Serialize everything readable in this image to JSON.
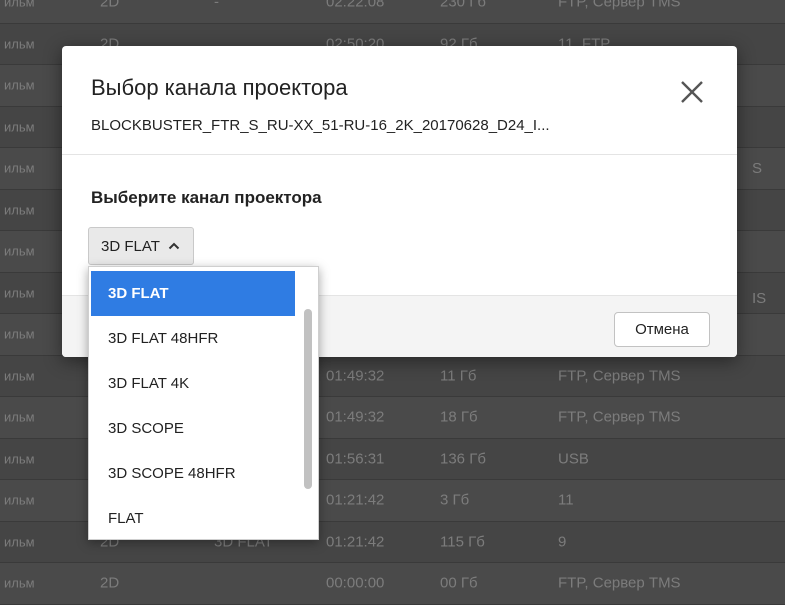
{
  "background_table": {
    "rows": [
      [
        "ильм",
        "2D",
        "-",
        "02:22:08",
        "230 Гб",
        "FTP, Сервер TMS"
      ],
      [
        "ильм",
        "2D",
        "",
        "02:50:20",
        "92 Гб",
        "11, FTP"
      ],
      [
        "ильм",
        "",
        "",
        "",
        "",
        ""
      ],
      [
        "ильм",
        "",
        "",
        "",
        "",
        ""
      ],
      [
        "ильм",
        "",
        "",
        "",
        "",
        ""
      ],
      [
        "ильм",
        "",
        "",
        "",
        "",
        ""
      ],
      [
        "ильм",
        "",
        "",
        "",
        "",
        ""
      ],
      [
        "ильм",
        "",
        "",
        "",
        "",
        ""
      ],
      [
        "ильм",
        "",
        "",
        "",
        "",
        ""
      ],
      [
        "ильм",
        "",
        "",
        "01:49:32",
        "11 Гб",
        "FTP, Сервер TMS"
      ],
      [
        "ильм",
        "",
        "",
        "01:49:32",
        "18 Гб",
        "FTP, Сервер TMS"
      ],
      [
        "ильм",
        "",
        "",
        "01:56:31",
        "136 Гб",
        "USB"
      ],
      [
        "ильм",
        "",
        "",
        "01:21:42",
        "3 Гб",
        "11"
      ],
      [
        "ильм",
        "2D",
        "3D FLAT",
        "01:21:42",
        "115 Гб",
        "9"
      ],
      [
        "ильм",
        "2D",
        "",
        "00:00:00",
        "00 Гб",
        "FTP, Сервер TMS"
      ]
    ],
    "right_edge_texts": [
      "S",
      "IS"
    ]
  },
  "modal": {
    "title": "Выбор канала проектора",
    "subtitle": "BLOCKBUSTER_FTR_S_RU-XX_51-RU-16_2K_20170628_D24_I...",
    "close_icon": "close-icon",
    "field_label": "Выберите канал проектора",
    "select_value": "3D FLAT",
    "select_icon": "chevron-up-icon",
    "cancel_label": "Отмена"
  },
  "dropdown": {
    "selected_index": 0,
    "options": [
      "3D FLAT",
      "3D FLAT 48HFR",
      "3D FLAT 4K",
      "3D SCOPE",
      "3D SCOPE 48HFR",
      "FLAT"
    ]
  },
  "colors": {
    "accent": "#2f7ce3",
    "overlay_bg": "#4a4a4a"
  }
}
